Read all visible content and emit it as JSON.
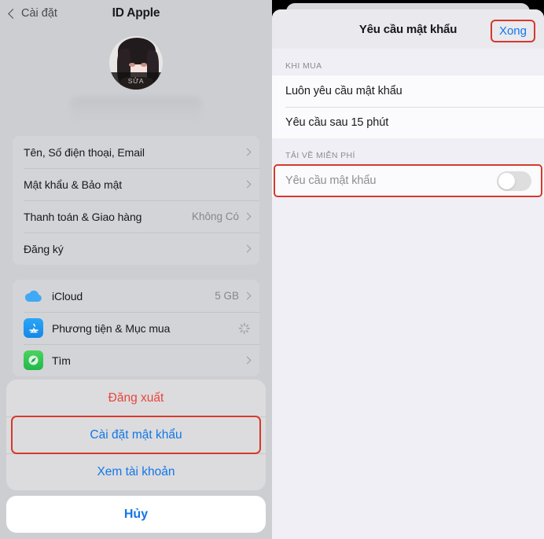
{
  "left": {
    "nav": {
      "back_label": "Cài đặt",
      "back_icon": "chevron-left-icon",
      "title": "ID Apple"
    },
    "profile": {
      "avatar_icon": "avatar",
      "edit_label": "SỬA"
    },
    "group1": [
      {
        "label": "Tên, Số điện thoại, Email",
        "value": "",
        "chevron": "chevron-right-icon"
      },
      {
        "label": "Mật khẩu & Bảo mật",
        "value": "",
        "chevron": "chevron-right-icon"
      },
      {
        "label": "Thanh toán & Giao hàng",
        "value": "Không Có",
        "chevron": "chevron-right-icon"
      },
      {
        "label": "Đăng ký",
        "value": "",
        "chevron": "chevron-right-icon"
      }
    ],
    "group2": [
      {
        "label": "iCloud",
        "value": "5 GB",
        "icon": "icloud-icon",
        "accessory": "chevron"
      },
      {
        "label": "Phương tiện & Mục mua",
        "value": "",
        "icon": "app-store-icon",
        "accessory": "spinner"
      },
      {
        "label": "Tìm",
        "value": "",
        "icon": "find-my-icon",
        "accessory": "chevron"
      }
    ],
    "action_sheet": {
      "items": [
        {
          "label": "Đăng xuất",
          "style": "destructive"
        },
        {
          "label": "Cài đặt mật khẩu",
          "style": "default",
          "highlighted": true
        },
        {
          "label": "Xem tài khoản",
          "style": "default"
        }
      ],
      "cancel_label": "Hủy"
    }
  },
  "right": {
    "modal": {
      "title": "Yêu cầu mật khẩu",
      "done_label": "Xong",
      "done_highlighted": true
    },
    "sections": [
      {
        "header": "KHI MUA",
        "rows": [
          {
            "label": "Luôn yêu cầu mật khẩu",
            "type": "plain"
          },
          {
            "label": "Yêu cầu sau 15 phút",
            "type": "plain"
          }
        ]
      },
      {
        "header": "TẢI VỀ MIỄN PHÍ",
        "rows": [
          {
            "label": "Yêu cầu mật khẩu",
            "type": "toggle",
            "toggle_on": false,
            "dim": true,
            "highlighted": true
          }
        ]
      }
    ]
  },
  "colors": {
    "accent_blue": "#1277e8",
    "destructive_red": "#e8453c",
    "highlight_red": "#d6392c",
    "left_bg": "#cdced2",
    "right_bg": "#f0eff5"
  }
}
